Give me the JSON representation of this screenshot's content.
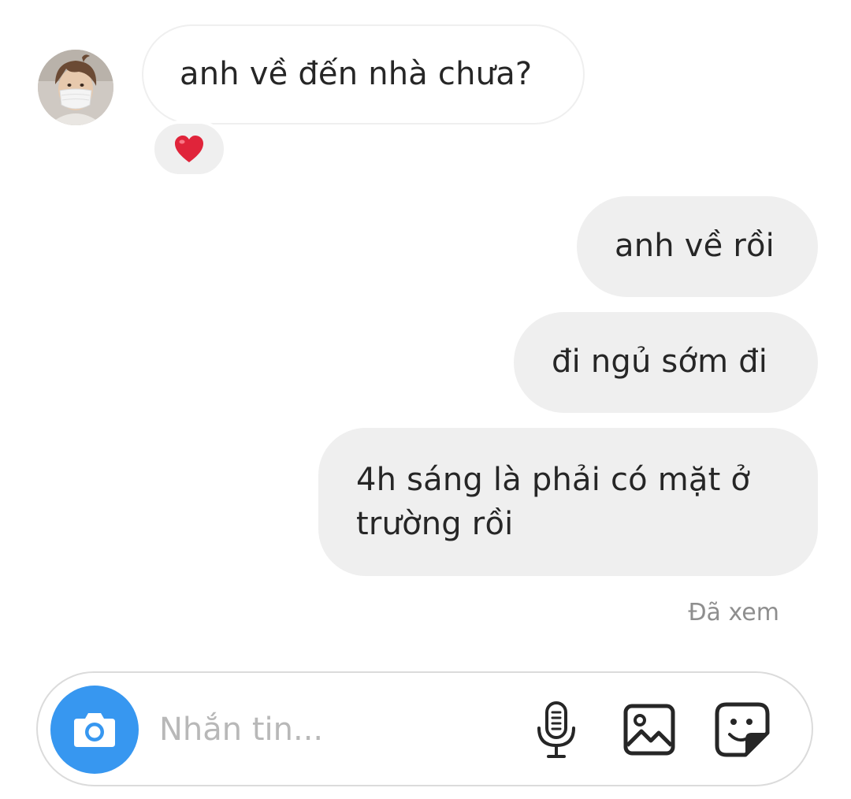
{
  "thread": {
    "messages": [
      {
        "from": "them",
        "text": "anh về đến nhà chưa?",
        "reaction": "heart-emoji"
      },
      {
        "from": "me",
        "text": "anh về rồi"
      },
      {
        "from": "me",
        "text": "đi ngủ sớm đi"
      },
      {
        "from": "me",
        "text": "4h sáng là phải có mặt ở trường rồi"
      }
    ],
    "seen_label": "Đã xem"
  },
  "composer": {
    "placeholder": "Nhắn tin...",
    "value": "",
    "camera_icon": "camera-icon",
    "mic_icon": "microphone-icon",
    "gallery_icon": "image-icon",
    "sticker_icon": "sticker-icon"
  },
  "colors": {
    "outgoing_bubble": "#efefef",
    "incoming_border": "#efefef",
    "camera_button": "#3797f0",
    "text": "#262626",
    "muted": "#8e8e8e",
    "heart": "#e0243a"
  }
}
